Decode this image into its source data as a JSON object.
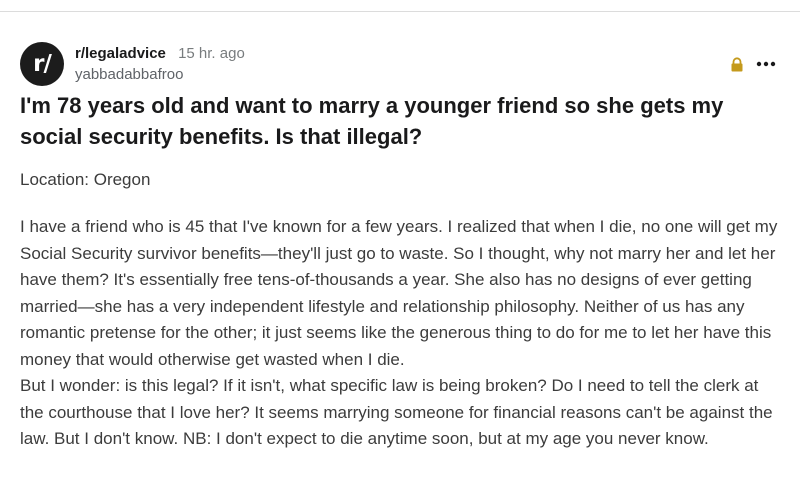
{
  "post": {
    "subreddit": "r/legaladvice",
    "time_ago": "15 hr. ago",
    "username": "yabbadabbafroo",
    "avatar_text": "r/",
    "avatar_icon": "subreddit-avatar",
    "lock_icon": "lock-icon",
    "more_icon": "more-options-icon",
    "title": "I'm 78 years old and want to marry a younger friend so she gets my social security benefits. Is that illegal?",
    "location": "Location: Oregon",
    "paragraphs": [
      "I have a friend who is 45 that I've known for a few years. I realized that when I die, no one will get my Social Security survivor benefits—they'll just go to waste. So I thought, why not marry her and let her have them? It's essentially free tens-of-thousands a year. She also has no designs of ever getting married—she has a very independent lifestyle and relationship philosophy. Neither of us has any romantic pretense for the other; it just seems like the generous thing to do for me to let her have this money that would otherwise get wasted when I die.",
      "But I wonder: is this legal? If it isn't, what specific law is being broken? Do I need to tell the clerk at the courthouse that I love her? It seems marrying someone for financial reasons can't be against the law. But I don't know. NB: I don't expect to die anytime soon, but at my age you never know."
    ]
  },
  "colors": {
    "lock": "#c49a1c",
    "avatar_bg": "#1c1c1c",
    "text": "#1a1a1b",
    "muted": "#787c7e"
  }
}
